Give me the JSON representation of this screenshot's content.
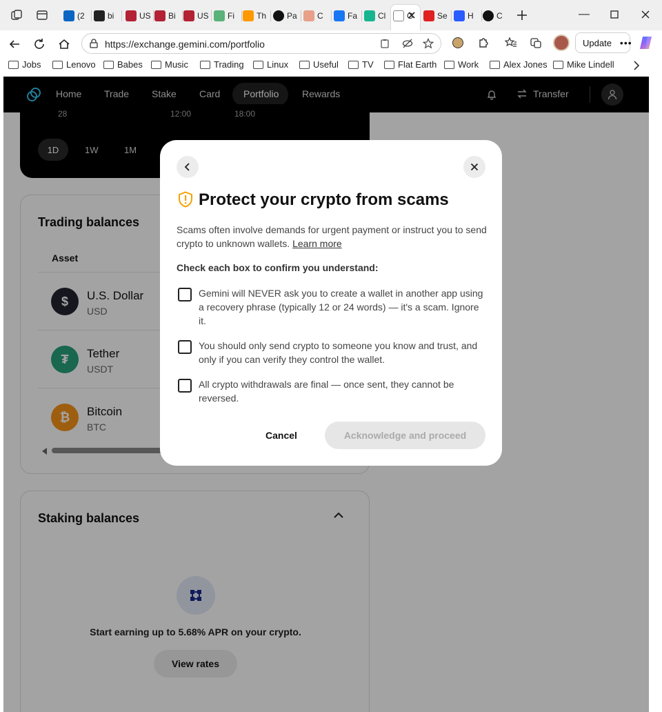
{
  "browser": {
    "tabs": [
      {
        "label": "(2",
        "icon": "linkedin-icon",
        "color": "#0a66c2"
      },
      {
        "label": "bi",
        "icon": "github-icon",
        "color": "#222222"
      },
      {
        "label": "US",
        "icon": "flag-icon",
        "color": "#b22234"
      },
      {
        "label": "Bi",
        "icon": "flag-icon",
        "color": "#b22234"
      },
      {
        "label": "US",
        "icon": "flag-icon",
        "color": "#b22234"
      },
      {
        "label": "Fi",
        "icon": "fi-icon",
        "color": "#59b27a"
      },
      {
        "label": "Th",
        "icon": "amazon-icon",
        "color": "#ff9900"
      },
      {
        "label": "Pa",
        "icon": "openai-icon",
        "color": "#111111"
      },
      {
        "label": "C",
        "icon": "image-icon",
        "color": "#e8a08a"
      },
      {
        "label": "Fa",
        "icon": "facebook-icon",
        "color": "#1877f2"
      },
      {
        "label": "Cl",
        "icon": "k-icon",
        "color": "#17b58f"
      },
      {
        "label": "G",
        "icon": "gemini-icon",
        "color": "#ffffff"
      },
      {
        "label": "Se",
        "icon": "g-red-icon",
        "color": "#e02020"
      },
      {
        "label": "H",
        "icon": "c-blue-icon",
        "color": "#2a5cff"
      },
      {
        "label": "C",
        "icon": "ring-icon",
        "color": "#111111"
      }
    ],
    "url": "https://exchange.gemini.com/portfolio",
    "update_label": "Update",
    "bookmarks": [
      "Jobs",
      "Lenovo",
      "Babes",
      "Music",
      "Trading",
      "Linux",
      "Useful",
      "TV",
      "Flat Earth",
      "Work",
      "Alex Jones",
      "Mike Lindell"
    ]
  },
  "site": {
    "nav": [
      "Home",
      "Trade",
      "Stake",
      "Card",
      "Portfolio",
      "Rewards"
    ],
    "transfer_label": "Transfer",
    "chart_ticks": [
      "28",
      "12:00",
      "18:00"
    ],
    "ranges": [
      "1D",
      "1W",
      "1M"
    ],
    "trading_title": "Trading balances",
    "asset_header": "Asset",
    "assets": [
      {
        "name": "U.S. Dollar",
        "symbol": "USD",
        "glyph": "$",
        "color": "#23232f"
      },
      {
        "name": "Tether",
        "symbol": "USDT",
        "glyph": "₮",
        "color": "#26a17b"
      },
      {
        "name": "Bitcoin",
        "symbol": "BTC",
        "glyph": "₿",
        "color": "#f7931a"
      }
    ],
    "staking_title": "Staking balances",
    "staking_text": "Start earning up to 5.68% APR on your crypto.",
    "view_rates": "View rates"
  },
  "modal": {
    "title": "Protect your crypto from scams",
    "intro": "Scams often involve demands for urgent payment or instruct you to send crypto to unknown wallets.",
    "learn_more": "Learn more",
    "instruction": "Check each box to confirm you understand:",
    "items": [
      "Gemini will NEVER ask you to create a wallet in another app using a recovery phrase (typically 12 or 24 words) — it's a scam. Ignore it.",
      "You should only send crypto to someone you know and trust, and only if you can verify they control the wallet.",
      "All crypto withdrawals are final — once sent, they cannot be reversed."
    ],
    "cancel": "Cancel",
    "proceed": "Acknowledge and proceed"
  }
}
